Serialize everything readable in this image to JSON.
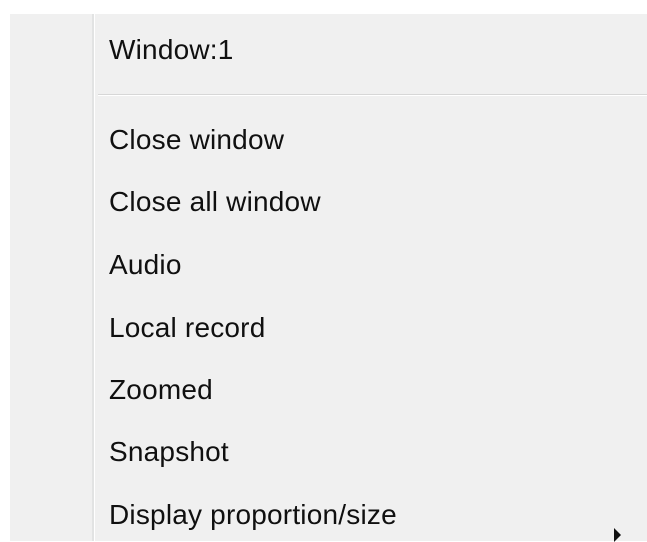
{
  "menu": {
    "header": "Window:1",
    "items": [
      {
        "label": "Close window"
      },
      {
        "label": "Close all window"
      },
      {
        "label": "Audio"
      },
      {
        "label": "Local record"
      },
      {
        "label": "Zoomed"
      },
      {
        "label": "Snapshot"
      },
      {
        "label": "Display proportion/size",
        "has_submenu": true
      }
    ]
  },
  "icons": {
    "submenu": "chevron-right-icon"
  },
  "colors": {
    "menu_background": "#f0f0f0",
    "text": "#101010",
    "separator": "#d7d7d7"
  }
}
